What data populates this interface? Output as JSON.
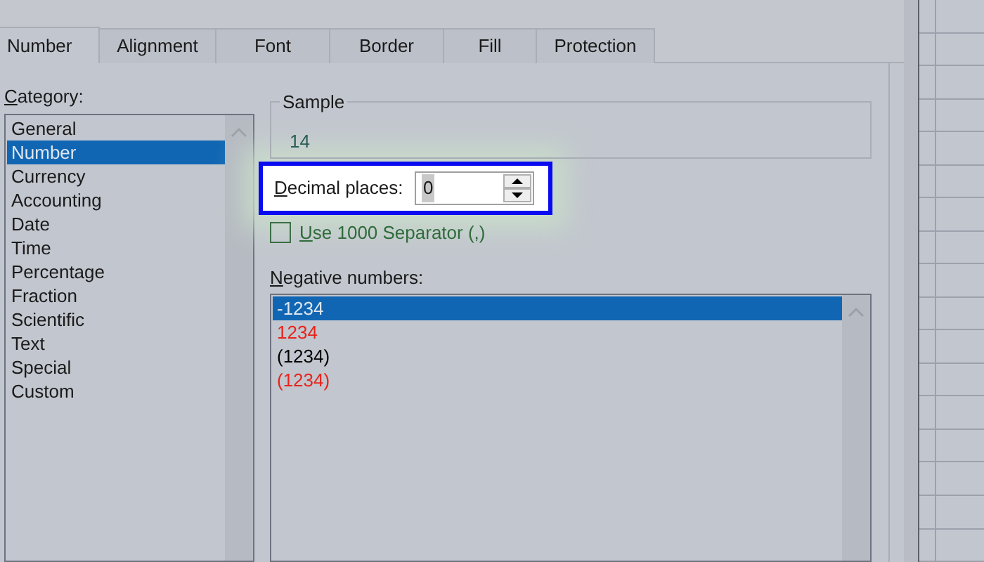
{
  "tabs": [
    {
      "label": "Number",
      "selected": true
    },
    {
      "label": "Alignment",
      "selected": false
    },
    {
      "label": "Font",
      "selected": false
    },
    {
      "label": "Border",
      "selected": false
    },
    {
      "label": "Fill",
      "selected": false
    },
    {
      "label": "Protection",
      "selected": false
    }
  ],
  "category": {
    "label": "Category:",
    "items": [
      {
        "label": "General",
        "selected": false
      },
      {
        "label": "Number",
        "selected": true
      },
      {
        "label": "Currency",
        "selected": false
      },
      {
        "label": "Accounting",
        "selected": false
      },
      {
        "label": "Date",
        "selected": false
      },
      {
        "label": "Time",
        "selected": false
      },
      {
        "label": "Percentage",
        "selected": false
      },
      {
        "label": "Fraction",
        "selected": false
      },
      {
        "label": "Scientific",
        "selected": false
      },
      {
        "label": "Text",
        "selected": false
      },
      {
        "label": "Special",
        "selected": false
      },
      {
        "label": "Custom",
        "selected": false
      }
    ]
  },
  "sample": {
    "label": "Sample",
    "value": "14"
  },
  "decimal_places": {
    "label": "Decimal places:",
    "value": "0",
    "highlighted": true
  },
  "separator": {
    "label": "Use 1000 Separator (,)",
    "checked": false
  },
  "negative_numbers": {
    "label": "Negative numbers:",
    "items": [
      {
        "label": "-1234",
        "selected": true
      },
      {
        "label": "1234",
        "selected": false,
        "color": "#e8241c"
      },
      {
        "label": "(1234)",
        "selected": false,
        "color": "#000000"
      },
      {
        "label": "(1234)",
        "selected": false,
        "color": "#e8241c"
      }
    ]
  }
}
